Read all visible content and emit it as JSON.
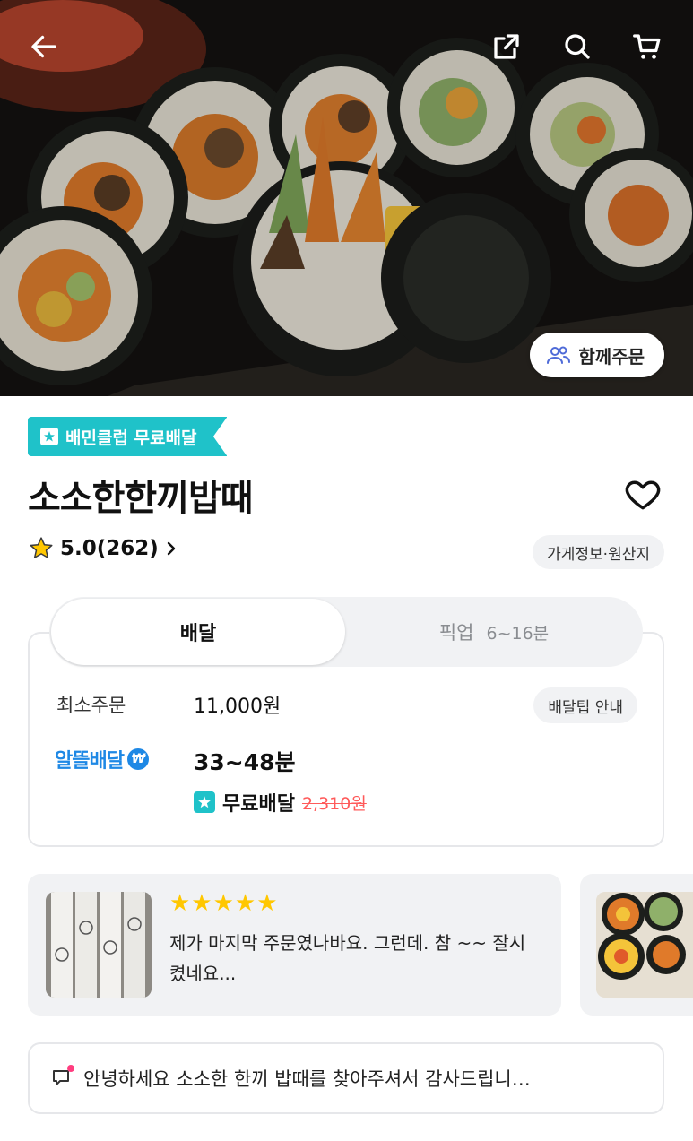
{
  "header": {
    "back_icon": "arrow-left-icon",
    "share_icon": "share-icon",
    "search_icon": "search-icon",
    "cart_icon": "cart-icon",
    "together_order_label": "함께주문"
  },
  "store": {
    "badge_label": "배민클럽 무료배달",
    "name": "소소한한끼밥때",
    "rating": "5.0(262)",
    "info_chip": "가게정보·원산지"
  },
  "order_tabs": {
    "delivery_label": "배달",
    "pickup_label": "픽업",
    "pickup_time": "6~16분"
  },
  "delivery_info": {
    "min_order_label": "최소주문",
    "min_order_value": "11,000원",
    "tip_chip": "배달팁 안내",
    "delivery_type": "알뜰배달",
    "eta": "33~48분",
    "free_label": "무료배달",
    "old_fee": "2,310원"
  },
  "reviews": [
    {
      "stars": "★★★★★",
      "rating": 5,
      "text": "제가 마지막 주문였나바요.  그런데. 참 ~~  잘시켰네요..."
    }
  ],
  "notice": {
    "text": "안녕하세요 소소한 한끼 밥때를 찾아주셔서 감사드립니…"
  },
  "colors": {
    "teal": "#1fc2c9",
    "blue": "#1e88e5",
    "star": "#ffc700",
    "strike": "#ff5a5a"
  }
}
